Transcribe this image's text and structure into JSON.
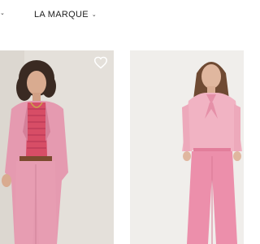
{
  "nav": {
    "items": [
      {
        "label": ""
      },
      {
        "label": "LA MARQUE"
      }
    ]
  },
  "products": [
    {
      "name": "model-pink-suit-striped-top",
      "favorite": false
    },
    {
      "name": "model-pink-blouse-trousers"
    }
  ],
  "colors": {
    "background": "#ffffff",
    "pink": "#e88fa8",
    "text": "#222222"
  },
  "icons": [
    "chevron-down-icon",
    "heart-outline-icon"
  ]
}
